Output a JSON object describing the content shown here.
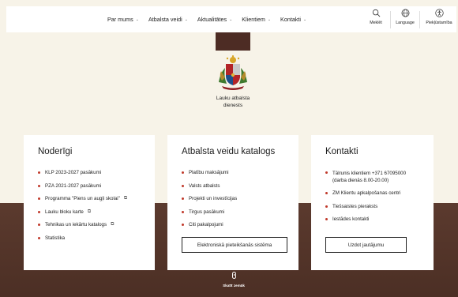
{
  "nav": {
    "items": [
      {
        "label": "Par mums"
      },
      {
        "label": "Atbalsta veidi"
      },
      {
        "label": "Aktualitātes"
      },
      {
        "label": "Klientiem"
      },
      {
        "label": "Kontakti"
      }
    ]
  },
  "tools": {
    "search": "Meklēt",
    "language": "Language",
    "accessibility": "Piekļūstamība"
  },
  "org": {
    "line1": "Lauku atbalsta",
    "line2": "dienests"
  },
  "cards": {
    "nodergi": {
      "title": "Noderīgi",
      "items": [
        {
          "label": "KLP 2023-2027 pasākumi",
          "external": false
        },
        {
          "label": "PZA 2021-2027 pasākumi",
          "external": false
        },
        {
          "label": "Programma \"Piens un augļi skolai\"",
          "external": true
        },
        {
          "label": "Lauku bloku karte",
          "external": true
        },
        {
          "label": "Tehnikas un iekārtu katalogs",
          "external": true
        },
        {
          "label": "Statistika",
          "external": false
        }
      ]
    },
    "katalogs": {
      "title": "Atbalsta veidu katalogs",
      "items": [
        {
          "label": "Platību maksājumi"
        },
        {
          "label": "Valsts atbalsts"
        },
        {
          "label": "Projekti un investīcijas"
        },
        {
          "label": "Tirgus pasākumi"
        },
        {
          "label": "Citi pakalpojumi"
        }
      ],
      "button": "Elektroniskā pieteikšanās sistēma"
    },
    "kontakti": {
      "title": "Kontakti",
      "items": [
        {
          "line1": "Tālrunis klientiem +371 67095000",
          "line2": "(darba dienās 8.00-20.00)"
        },
        {
          "line1": "ZM Klientu apkalpošanas centri",
          "line2": ""
        },
        {
          "line1": "Tiešsaistes pieraksts",
          "line2": ""
        },
        {
          "line1": "Iestādes kontakti",
          "line2": ""
        }
      ],
      "button": "Uzdot jautājumu"
    }
  },
  "scroll_label": "Skatīt zemāk",
  "external_icon": "external-link-icon",
  "colors": {
    "background": "#f7f3e8",
    "brown": "#5b3a2e",
    "bullet": "#c0392b"
  }
}
